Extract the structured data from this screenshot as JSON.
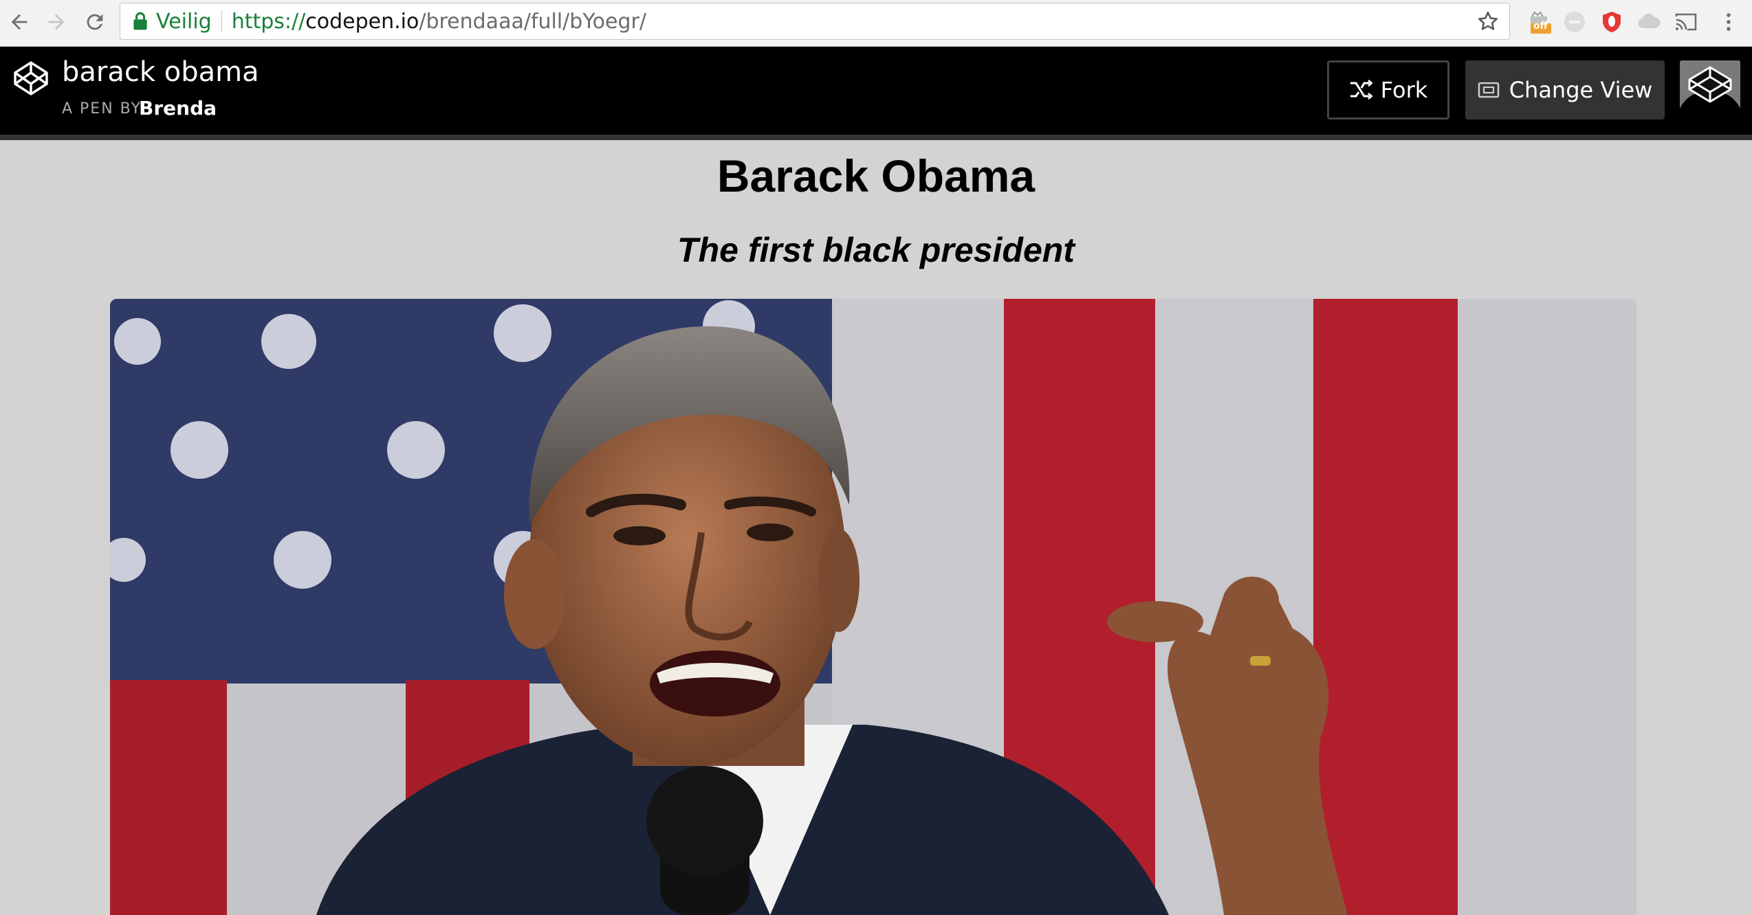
{
  "browser": {
    "secure_label": "Veilig",
    "url_scheme": "https://",
    "url_host": "codepen.io",
    "url_path": "/brendaaa/full/bYoegr/",
    "extension_badge": "off"
  },
  "codepen": {
    "pen_title": "barack obama",
    "pen_by_label": "A PEN BY",
    "author": "Brenda",
    "fork_label": "Fork",
    "change_view_label": "Change View"
  },
  "page": {
    "title": "Barack Obama",
    "subtitle": "The first black president"
  },
  "colors": {
    "page_background": "#d3d3d3",
    "header_background": "#000000",
    "secure_green": "#188038"
  }
}
